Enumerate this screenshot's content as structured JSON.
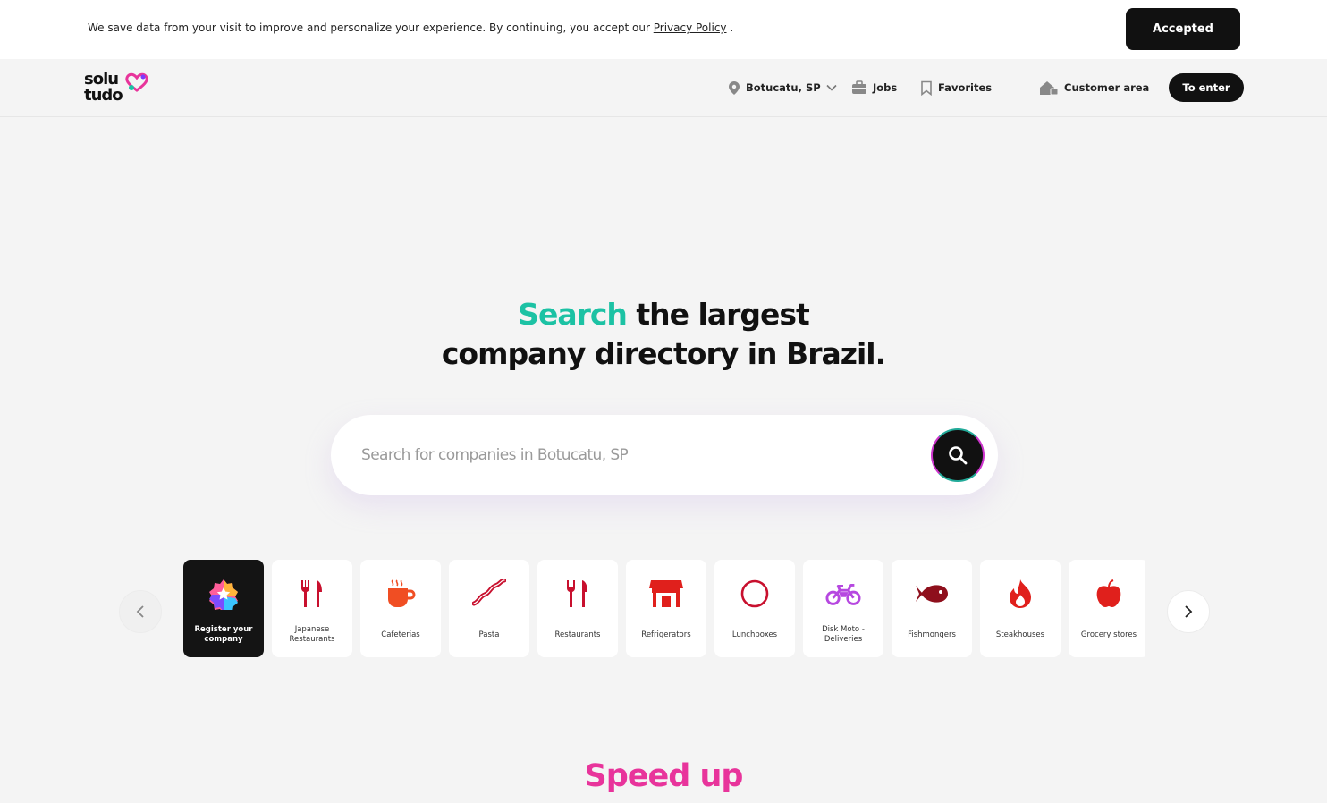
{
  "cookie": {
    "text": "We save data from your visit to improve and personalize your experience. By continuing, you accept our ",
    "link": "Privacy Policy",
    "suffix": " .",
    "button": "Accepted"
  },
  "header": {
    "logo_top": "solu",
    "logo_bottom": "tudo",
    "location": "Botucatu, SP",
    "jobs": "Jobs",
    "favorites": "Favorites",
    "customer_area": "Customer area",
    "enter": "To enter"
  },
  "hero": {
    "accent": "Search",
    "line1_rest": " the largest",
    "line2": "company directory in Brazil.",
    "search_placeholder": "Search for companies in Botucatu, SP"
  },
  "categories": [
    {
      "label": "Register your company",
      "icon": "star-badge-icon"
    },
    {
      "label": "Japanese Restaurants",
      "icon": "fork-knife-icon"
    },
    {
      "label": "Cafeterias",
      "icon": "coffee-cup-icon"
    },
    {
      "label": "Pasta",
      "icon": "bacon-icon"
    },
    {
      "label": "Restaurants",
      "icon": "fork-knife-icon"
    },
    {
      "label": "Refrigerators",
      "icon": "shop-icon"
    },
    {
      "label": "Lunchboxes",
      "icon": "circle-icon"
    },
    {
      "label": "Disk Moto - Deliveries",
      "icon": "motorcycle-icon"
    },
    {
      "label": "Fishmongers",
      "icon": "fish-icon"
    },
    {
      "label": "Steakhouses",
      "icon": "flame-icon"
    },
    {
      "label": "Grocery stores",
      "icon": "apple-icon"
    }
  ],
  "colors": {
    "accent": "#1cc2a4",
    "speed": "#e8349b",
    "red": "#c8102e",
    "orange": "#f04e23",
    "purple": "#b648e0"
  },
  "section": {
    "speed_title": "Speed up"
  }
}
